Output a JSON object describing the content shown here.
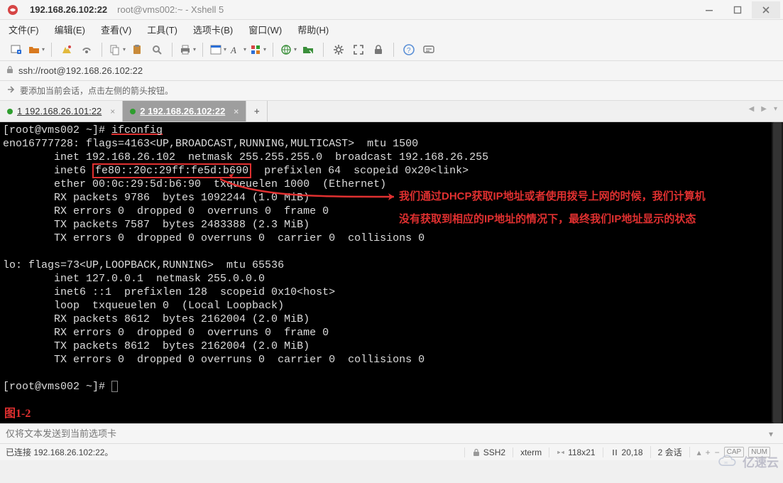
{
  "titlebar": {
    "tab_title": "192.168.26.102:22",
    "sub_title": "root@vms002:~ - Xshell 5"
  },
  "menu": {
    "file": "文件(F)",
    "edit": "编辑(E)",
    "view": "查看(V)",
    "tools": "工具(T)",
    "tab": "选项卡(B)",
    "window": "窗口(W)",
    "help": "帮助(H)"
  },
  "toolbar_icons": {
    "new_session": "new-session-icon",
    "open": "open-icon",
    "connect": "connect-icon",
    "disconnect": "disconnect-icon",
    "copy": "copy-icon",
    "paste": "paste-icon",
    "find": "find-icon",
    "print": "print-icon",
    "properties": "properties-icon",
    "font": "font-icon",
    "colors": "colors-icon",
    "web": "web-icon",
    "xftp": "xftp-icon",
    "settings": "settings-icon",
    "fullscreen": "fullscreen-icon",
    "lock": "lock-icon",
    "help": "help-icon",
    "compose": "compose-icon"
  },
  "address_bar": {
    "value": "ssh://root@192.168.26.102:22"
  },
  "hint_bar": {
    "text": "要添加当前会话，点击左侧的箭头按钮。"
  },
  "session_tabs": {
    "tab1_label": "1 192.168.26.101:22",
    "tab2_label": "2 192.168.26.102:22",
    "add_label": "+"
  },
  "terminal": {
    "prompt1": "[root@vms002 ~]# ",
    "command1": "ifconfig",
    "line_if": "eno16777728: flags=4163<UP,BROADCAST,RUNNING,MULTICAST>  mtu 1500",
    "line_inet_a": "        inet 192.168.26.102  netmask 255.255.255.0  broadcast 192.168.26.255",
    "line_inet6_a1": "        inet6 ",
    "ipv6": "fe80::20c:29ff:fe5d:b690",
    "line_inet6_a2": "  prefixlen 64  scopeid 0x20<link>",
    "line_ether": "        ether 00:0c:29:5d:b6:90  txqueuelen 1000  (Ethernet)",
    "line_rx1": "        RX packets 9786  bytes 1092244 (1.0 MiB)",
    "line_rxerr1": "        RX errors 0  dropped 0  overruns 0  frame 0",
    "line_tx1": "        TX packets 7587  bytes 2483388 (2.3 MiB)",
    "line_txerr1": "        TX errors 0  dropped 0 overruns 0  carrier 0  collisions 0",
    "line_lo": "lo: flags=73<UP,LOOPBACK,RUNNING>  mtu 65536",
    "line_lo_inet": "        inet 127.0.0.1  netmask 255.0.0.0",
    "line_lo_inet6": "        inet6 ::1  prefixlen 128  scopeid 0x10<host>",
    "line_lo_loop": "        loop  txqueuelen 0  (Local Loopback)",
    "line_lo_rx": "        RX packets 8612  bytes 2162004 (2.0 MiB)",
    "line_lo_rxerr": "        RX errors 0  dropped 0  overruns 0  frame 0",
    "line_lo_tx": "        TX packets 8612  bytes 2162004 (2.0 MiB)",
    "line_lo_txerr": "        TX errors 0  dropped 0 overruns 0  carrier 0  collisions 0",
    "prompt2": "[root@vms002 ~]# ",
    "annotation_line1": "我们通过DHCP获取IP地址或者使用拨号上网的时候，我们计算机",
    "annotation_line2": "没有获取到相应的IP地址的情况下，最终我们IP地址显示的状态",
    "figure_label": "图1-2"
  },
  "compose": {
    "placeholder": "仅将文本发送到当前选项卡"
  },
  "statusbar": {
    "conn": "已连接 192.168.26.102:22。",
    "proto": "SSH2",
    "termtype": "xterm",
    "size": "118x21",
    "cursor": "20,18",
    "sessions": "2 会话",
    "badge1": "CAP",
    "badge2": "NUM"
  },
  "watermark": {
    "text": "亿速云"
  }
}
